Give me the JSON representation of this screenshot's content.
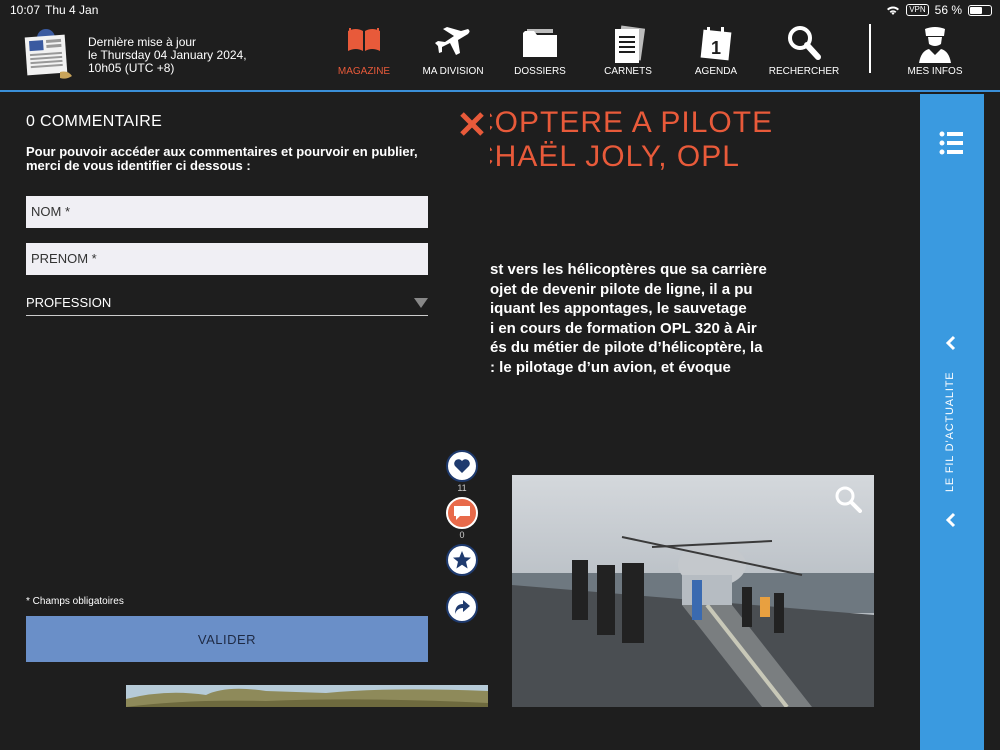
{
  "status": {
    "time": "10:07",
    "date": "Thu 4 Jan",
    "vpn": "VPN",
    "battery": "56 %"
  },
  "header": {
    "update_line1": "Dernière mise à jour",
    "update_line2": "le Thursday 04 January 2024,",
    "update_line3": "10h05 (UTC +8)",
    "nav": [
      {
        "label": "MAGAZINE",
        "icon": "book-icon",
        "active": true
      },
      {
        "label": "MA DIVISION",
        "icon": "airplane-icon",
        "active": false
      },
      {
        "label": "DOSSIERS",
        "icon": "folder-icon",
        "active": false
      },
      {
        "label": "CARNETS",
        "icon": "notebook-icon",
        "active": false
      },
      {
        "label": "AGENDA",
        "icon": "calendar-icon",
        "active": false,
        "badge": "1"
      },
      {
        "label": "RECHERCHER",
        "icon": "search-icon",
        "active": false
      },
      {
        "label": "MES INFOS",
        "icon": "pilot-user-icon",
        "active": false
      }
    ],
    "accent": "#e85a3a",
    "rule_color": "#3a8fd8"
  },
  "article": {
    "title_line1": "COPTERE A PILOTE",
    "title_line2": "CHAËL JOLY, OPL",
    "intro": "st vers les hélicoptères que sa carrière\nojet de devenir pilote de ligne, il a pu\niquant les appontages, le sauvetage\ni en cours de formation OPL 320 à Air\nés du métier de pilote d’hélicoptère, la\n: le pilotage d’un avion, et évoque"
  },
  "actions": {
    "likes": "11",
    "comments": "0"
  },
  "comments_panel": {
    "title": "0 COMMENTAIRE",
    "intro": "Pour pouvoir accéder aux commentaires et pourvoir en publier, merci de vous identifier ci dessous :",
    "nom_placeholder": "NOM *",
    "prenom_placeholder": "PRENOM *",
    "profession_label": "PROFESSION",
    "required_note": "* Champs obligatoires",
    "submit_label": "VALIDER",
    "submit_color": "#6a8fc8"
  },
  "sidebar": {
    "label": "LE FIL D’ACTUALITE",
    "color": "#3a9ae0"
  }
}
